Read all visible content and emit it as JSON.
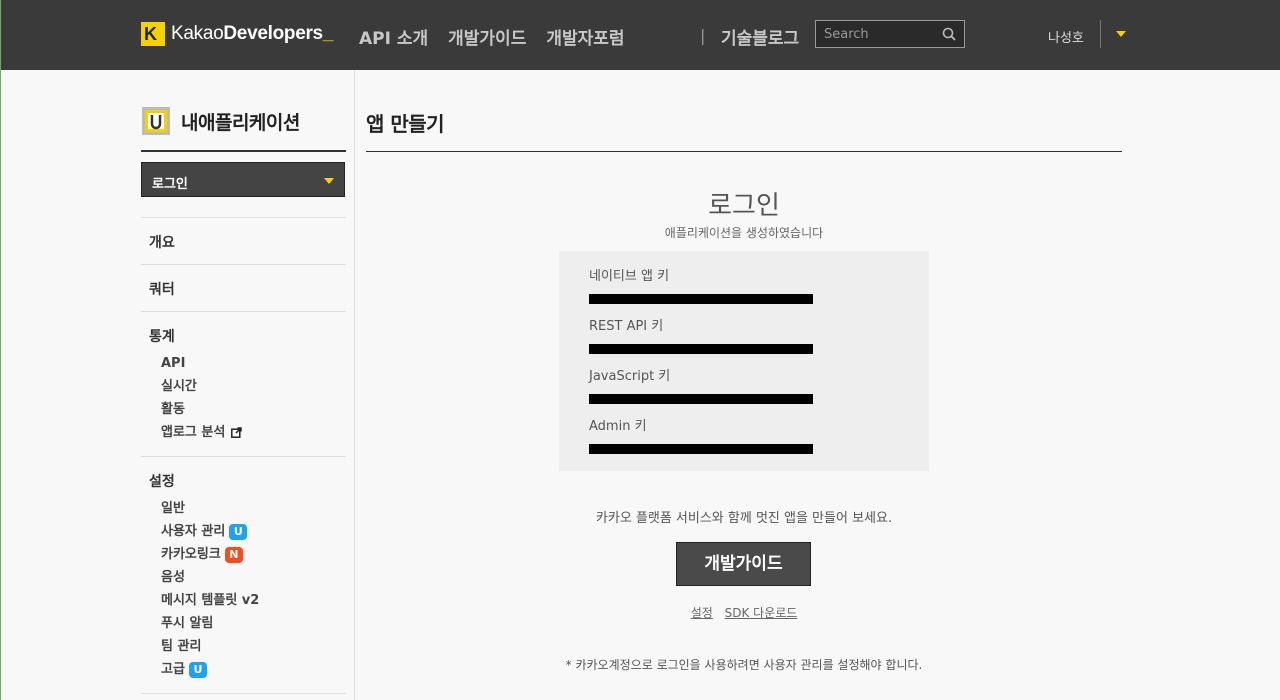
{
  "header": {
    "logo_k": "K",
    "logo_text_light": "Kakao",
    "logo_text_bold": "Developers",
    "logo_cursor": "_",
    "nav": [
      "API 소개",
      "개발가이드",
      "개발자포럼"
    ],
    "separator": "|",
    "blog": "기술블로그",
    "search_placeholder": "Search",
    "username": "나성호"
  },
  "sidebar": {
    "title": "내애플리케이션",
    "selected_app": "로그인",
    "groups": [
      {
        "head": "개요",
        "items": []
      },
      {
        "head": "쿼터",
        "items": []
      },
      {
        "head": "통계",
        "items": [
          "API",
          "실시간",
          "활동",
          "앱로그 분석"
        ]
      },
      {
        "head": "설정",
        "items": [
          "일반",
          "사용자 관리",
          "카카오링크",
          "음성",
          "메시지 템플릿 v2",
          "푸시 알림",
          "팀 관리",
          "고급"
        ]
      }
    ],
    "badges": {
      "user_mgmt": "U",
      "kakaolink": "N",
      "advanced": "U"
    }
  },
  "main": {
    "page_title": "앱 만들기",
    "app_name": "로그인",
    "app_created_msg": "애플리케이션을 생성하였습니다",
    "keys": [
      {
        "label": "네이티브 앱 키"
      },
      {
        "label": "REST API 키"
      },
      {
        "label": "JavaScript 키"
      },
      {
        "label": "Admin 키"
      }
    ],
    "promo": "카카오 플랫폼 서비스와 함께 멋진 앱을 만들어 보세요.",
    "guide_button": "개발가이드",
    "links": [
      "설정",
      "SDK 다운로드"
    ],
    "note": "* 카카오계정으로 로그인을 사용하려면 사용자 관리를 설정해야 합니다."
  },
  "colors": {
    "header_bg": "#3a3a3a",
    "accent_yellow": "#f5d100",
    "badge_blue": "#1fa2f0",
    "badge_red": "#f14e23",
    "button_bg": "#4a4a4a"
  }
}
